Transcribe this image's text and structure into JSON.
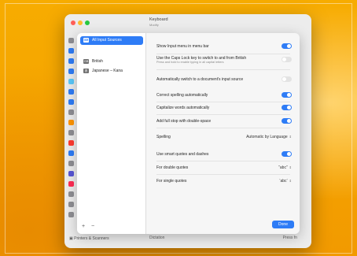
{
  "window": {
    "title": "Keyboard",
    "subtitle": "Modify",
    "footer_left": "Printers & Scanners",
    "footer_center": "Dictation",
    "footer_right": "Press fn"
  },
  "sidebar_icon_colors": [
    "#8e8e93",
    "#2e7cf6",
    "#2e7cf6",
    "#2e7cf6",
    "#5ac8fa",
    "#2e7cf6",
    "#2e7cf6",
    "#8e8e93",
    "#ff9500",
    "#8e8e93",
    "#ff3b30",
    "#2e7cf6",
    "#8e8e93",
    "#5856d6",
    "#ff2d55",
    "#8e8e93",
    "#8e8e93",
    "#8e8e93"
  ],
  "input_sources": {
    "items": [
      {
        "label": "All Input Sources",
        "icon": "keyboard-icon",
        "selected": true
      },
      {
        "label": "British",
        "icon": "flag-icon",
        "selected": false
      },
      {
        "label": "Japanese – Kana",
        "icon": "kana-icon",
        "selected": false
      }
    ],
    "add_label": "+",
    "remove_label": "−"
  },
  "options": {
    "show_menu": {
      "label": "Show Input menu in menu bar",
      "on": true
    },
    "caps_lock": {
      "label": "Use the Caps Lock key to switch to and from British",
      "sub": "Press and hold to enable typing in all capital letters",
      "on": false
    },
    "auto_switch": {
      "label": "Automatically switch to a document's input source",
      "on": false
    },
    "autocorrect": {
      "label": "Correct spelling automatically",
      "on": true
    },
    "capitalize": {
      "label": "Capitalize words automatically",
      "on": true
    },
    "period": {
      "label": "Add full stop with double-space",
      "on": true
    },
    "spelling": {
      "label": "Spelling",
      "value": "Automatic by Language"
    },
    "smart_quotes": {
      "label": "Use smart quotes and dashes",
      "on": true
    },
    "double_quotes": {
      "label": "For double quotes",
      "value": "“abc”"
    },
    "single_quotes": {
      "label": "For single quotes",
      "value": "‘abc’"
    }
  },
  "done_label": "Done"
}
